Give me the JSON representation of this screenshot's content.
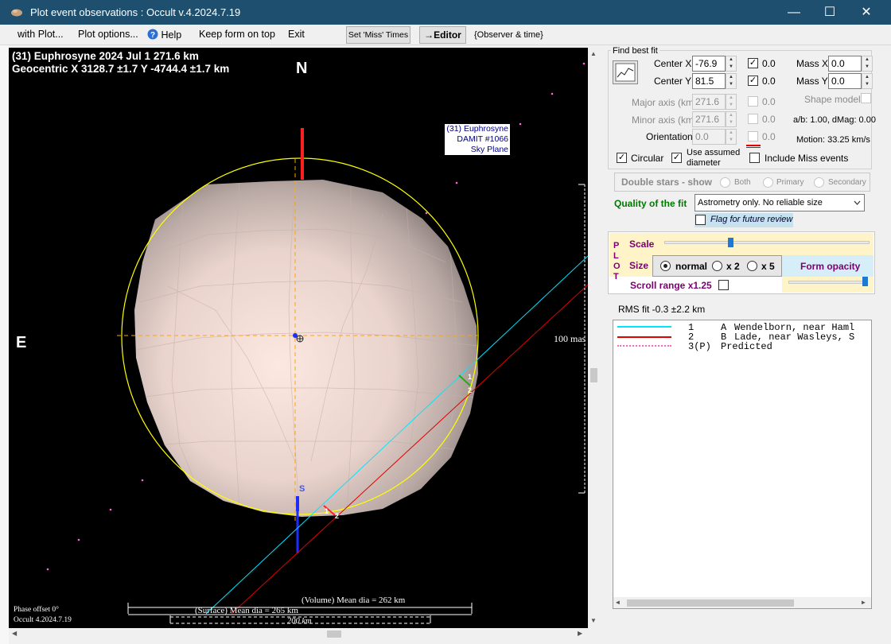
{
  "window": {
    "title": "Plot event observations : Occult v.4.2024.7.19",
    "minimize": "—",
    "maximize": "☐",
    "close": "✕"
  },
  "menu": {
    "with_plot": "with Plot...",
    "plot_options": "Plot options...",
    "help": "Help",
    "keep_on_top": "Keep form on top",
    "exit": "Exit",
    "set_miss_times": "Set 'Miss' Times",
    "editor": "→Editor",
    "observer_time": "{Observer & time}"
  },
  "plot": {
    "title_line1": "(31) Euphrosyne  2024 Jul 1  271.6 km",
    "title_line2": "Geocentric  X  3128.7 ±1.7  Y -4744.4 ±1.7 km",
    "north": "N",
    "east": "E",
    "south": "S",
    "model_legend": [
      "(31) Euphrosyne",
      "DAMIT #1066",
      "Sky Plane"
    ],
    "scale_label": "100 mas",
    "phase_offset": "Phase offset 0°",
    "version": "Occult 4.2024.7.19",
    "volume_dia": "(Volume) Mean dia = 262 km",
    "surface_dia": "(Surface) Mean dia = 265 km",
    "km_scale": "200 km",
    "chord_labels": [
      "1",
      "2",
      "1",
      "2"
    ]
  },
  "fit": {
    "group_label": "Find best fit",
    "center_x_label": "Center X",
    "center_x": "-76.9",
    "center_y_label": "Center Y",
    "center_y": "81.5",
    "cx_check_value": "0.0",
    "cy_check_value": "0.0",
    "mass_x_label": "Mass X",
    "mass_x": "0.0",
    "mass_y_label": "Mass Y",
    "mass_y": "0.0",
    "major_label": "Major axis (km)",
    "major": "271.6",
    "major_check_value": "0.0",
    "minor_label": "Minor axis (km)",
    "minor": "271.6",
    "minor_check_value": "0.0",
    "orient_label": "Orientation",
    "orient": "0.0",
    "orient_check_value": "0.0",
    "shape_model": "Shape model",
    "ab_dmag": "a/b: 1.00, dMag: 0.00",
    "motion": "Motion: 33.25 km/s",
    "circular": "Circular",
    "use_assumed": "Use assumed",
    "diameter": "diameter",
    "include_miss": "Include Miss events",
    "double_stars": "Double stars - show",
    "both": "Both",
    "primary": "Primary",
    "secondary": "Secondary",
    "quality_label": "Quality of the fit",
    "quality_value": "Astrometry only. No reliable size",
    "flag_review": "Flag for future review"
  },
  "plot_controls": {
    "side_label": [
      "P",
      "L",
      "O",
      "T"
    ],
    "scale": "Scale",
    "scale_level": 0.32,
    "size": "Size",
    "normal": "normal",
    "x2": "x 2",
    "x5": "x 5",
    "form_opacity": "Form opacity",
    "opacity_level": 1.0,
    "scroll_range": "Scroll range x1.25"
  },
  "rms": "RMS fit -0.3 ±2.2 km",
  "observers": [
    {
      "num": "1",
      "code": "A",
      "name": "Wendelborn, near Haml",
      "color": "#00e5ff"
    },
    {
      "num": "2",
      "code": "B",
      "name": "Lade, near Wasleys, S",
      "color": "#e00000"
    },
    {
      "num": "3(P)",
      "code": "",
      "name": "Predicted",
      "color": "#ff66cc"
    }
  ],
  "colors": {
    "titlebar": "#1e4f6e",
    "limb": "#ffff00",
    "chord1": "#00e5ff",
    "chord2": "#e00000",
    "axes": "#ffa500"
  }
}
